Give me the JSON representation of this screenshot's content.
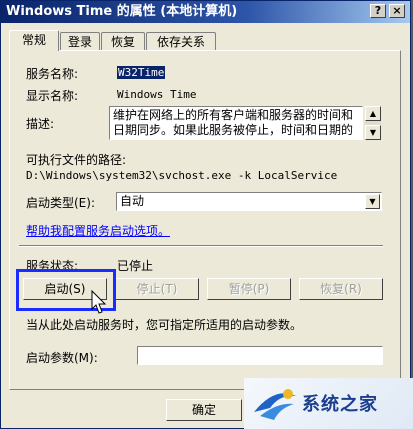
{
  "window": {
    "title": "Windows Time 的属性 (本地计算机)",
    "help_button": "?",
    "close_button": "×"
  },
  "tabs": [
    {
      "label": "常规",
      "active": true
    },
    {
      "label": "登录",
      "active": false
    },
    {
      "label": "恢复",
      "active": false
    },
    {
      "label": "依存关系",
      "active": false
    }
  ],
  "general": {
    "service_name_label": "服务名称:",
    "service_name": "W32Time",
    "display_name_label": "显示名称:",
    "display_name": "Windows Time",
    "description_label": "描述:",
    "description": "维护在网络上的所有客户端和服务器的时间和日期同步。如果此服务被停止，时间和日期的",
    "path_label": "可执行文件的路径:",
    "path": "D:\\Windows\\system32\\svchost.exe -k LocalService",
    "startup_type_label": "启动类型(E):",
    "startup_type": "自动",
    "help_link": "帮助我配置服务启动选项。",
    "status_label": "服务状态:",
    "status": "已停止",
    "start_params_hint": "当从此处启动服务时，您可指定所适用的启动参数。",
    "start_params_label": "启动参数(M):",
    "start_params_value": ""
  },
  "buttons": {
    "start": "启动(S)",
    "stop": "停止(T)",
    "pause": "暂停(P)",
    "resume": "恢复(R)",
    "ok": "确定"
  },
  "watermark": {
    "text": "系统之家"
  },
  "colors": {
    "title_bar": "#0a246a",
    "highlight_box": "#1a2cff",
    "link": "#0000ff"
  }
}
